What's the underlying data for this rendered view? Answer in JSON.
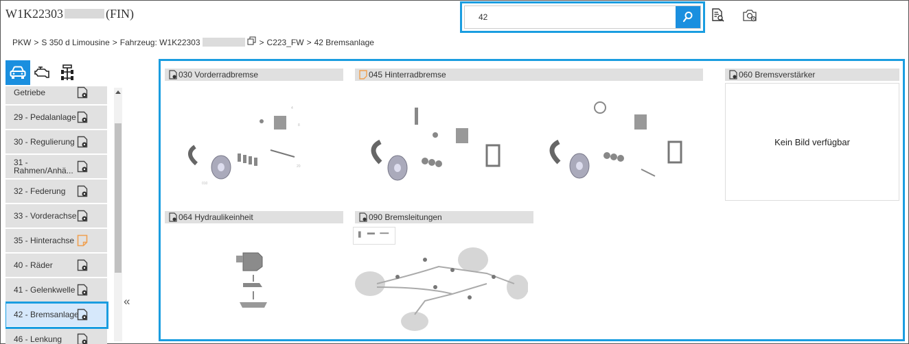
{
  "header": {
    "vin_prefix": "W1K22303",
    "vin_suffix": "(FIN)",
    "search_value": "42"
  },
  "breadcrumb": {
    "pkw": "PKW",
    "model": "S 350 d Limousine",
    "vehicle_label": "Fahrzeug: W1K22303",
    "code": "C223_FW",
    "group": "42 Bremsanlage",
    "sep": ">"
  },
  "sidebar": {
    "items": [
      {
        "label": "Getriebe",
        "status": "ok"
      },
      {
        "label": "29 - Pedalanlage",
        "status": "ok"
      },
      {
        "label": "30 - Regulierung",
        "status": "ok"
      },
      {
        "label": "31 - Rahmen/Anhä...",
        "status": "ok"
      },
      {
        "label": "32 - Federung",
        "status": "ok"
      },
      {
        "label": "33 - Vorderachse",
        "status": "ok"
      },
      {
        "label": "35 - Hinterachse",
        "status": "warn"
      },
      {
        "label": "40 - Räder",
        "status": "ok"
      },
      {
        "label": "41 - Gelenkwelle",
        "status": "ok"
      },
      {
        "label": "42 - Bremsanlage",
        "status": "ok",
        "selected": true
      },
      {
        "label": "46 - Lenkung",
        "status": "ok"
      }
    ],
    "collapse_symbol": "«"
  },
  "groups": [
    {
      "title": "030 Vorderradbremse",
      "status": "ok"
    },
    {
      "title": "045 Hinterradbremse",
      "status": "warn"
    },
    {
      "title": "060 Bremsverstärker",
      "status": "ok",
      "no_image": "Kein Bild verfügbar"
    },
    {
      "title": "064 Hydraulikeinheit",
      "status": "ok"
    },
    {
      "title": "090 Bremsleitungen",
      "status": "ok"
    }
  ],
  "colors": {
    "accent": "#1a9de0",
    "button": "#1a8fdf",
    "warn": "#f0a050",
    "item_bg": "#e1e1e1",
    "header_bg": "#e0e0e0"
  }
}
